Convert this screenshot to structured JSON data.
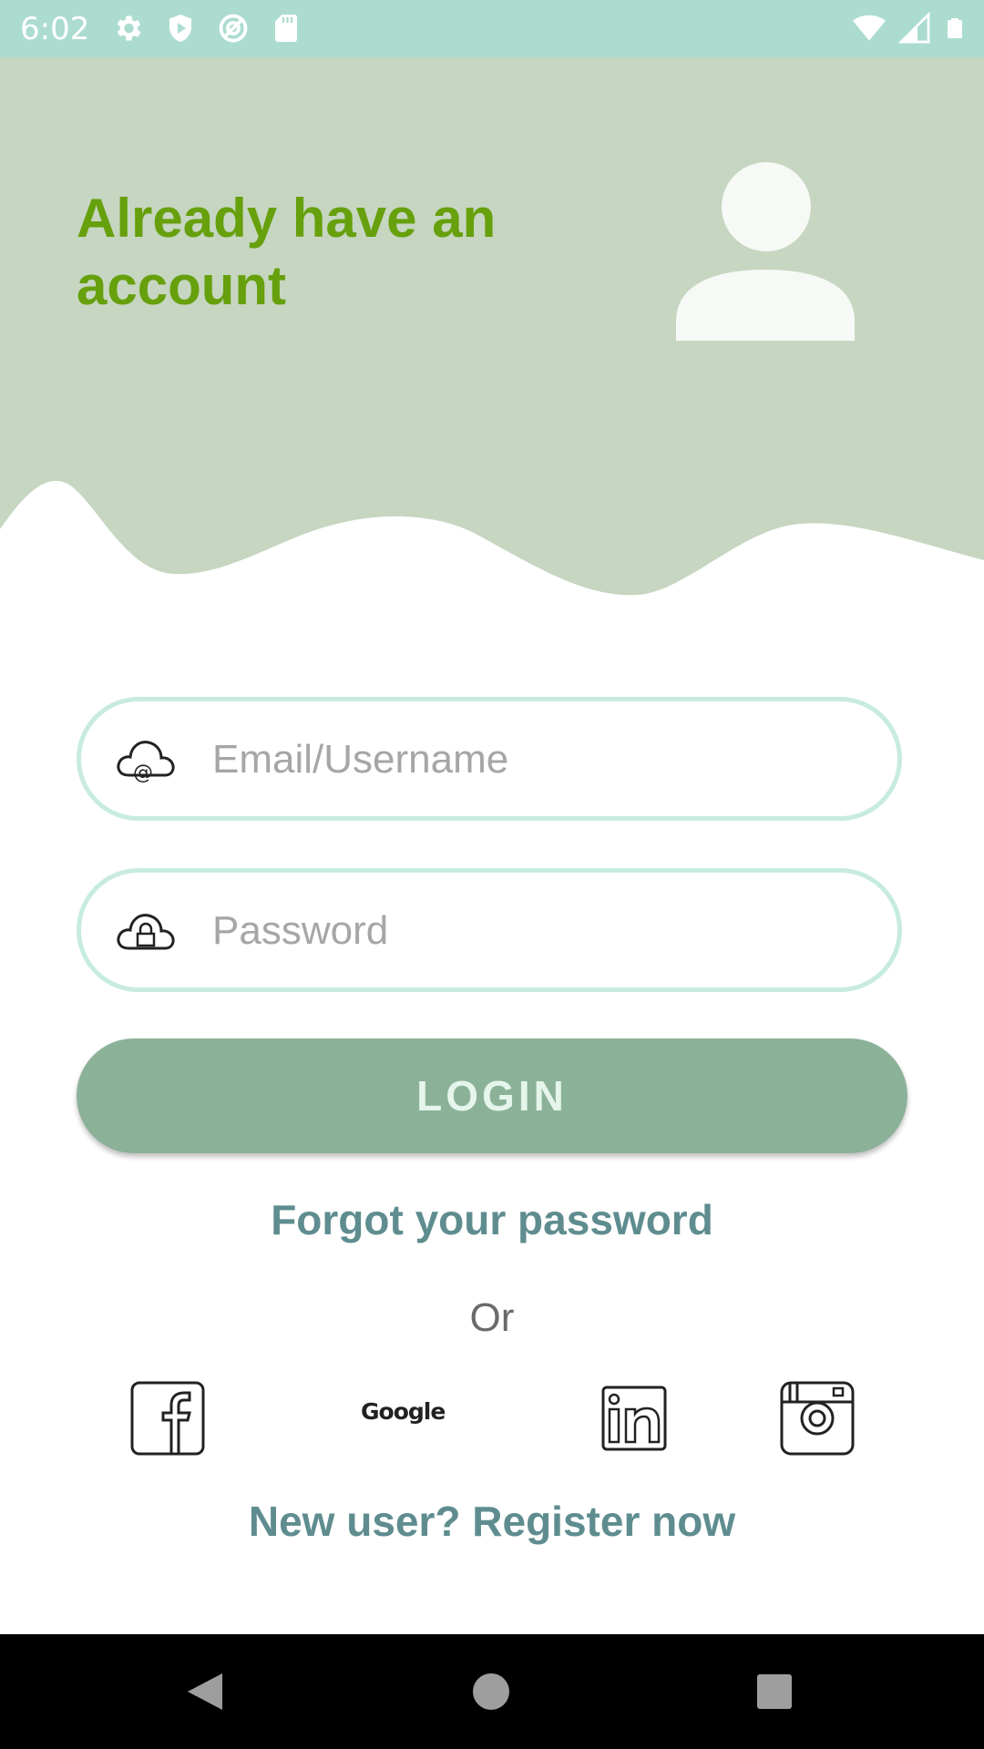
{
  "status_bar": {
    "time": "6:02",
    "left_icons": [
      "settings-gear-icon",
      "shield-play-icon",
      "sync-at-icon",
      "sd-card-icon"
    ],
    "right_icons": [
      "wifi-icon",
      "cell-signal-icon",
      "battery-icon"
    ]
  },
  "header": {
    "title": "Already have an account",
    "avatar_icon": "user-avatar-icon",
    "background_color": "#c6d6c1",
    "title_color": "#66a00c"
  },
  "form": {
    "email": {
      "placeholder": "Email/Username",
      "value": "",
      "icon": "cloud-at-icon"
    },
    "password": {
      "placeholder": "Password",
      "value": "",
      "icon": "cloud-lock-icon"
    },
    "login_label": "LOGIN",
    "login_color": "#8bb298",
    "field_border_color": "#c7ecdd"
  },
  "links": {
    "forgot_password": "Forgot your password",
    "or": "Or",
    "register": "New user? Register now",
    "link_color": "#5f8d8f"
  },
  "social": {
    "facebook_icon": "facebook-icon",
    "google_label": "Google",
    "linkedin_icon": "linkedin-icon",
    "instagram_icon": "instagram-icon"
  },
  "nav_bar": {
    "buttons": [
      "back-icon",
      "home-icon",
      "recents-icon"
    ]
  }
}
